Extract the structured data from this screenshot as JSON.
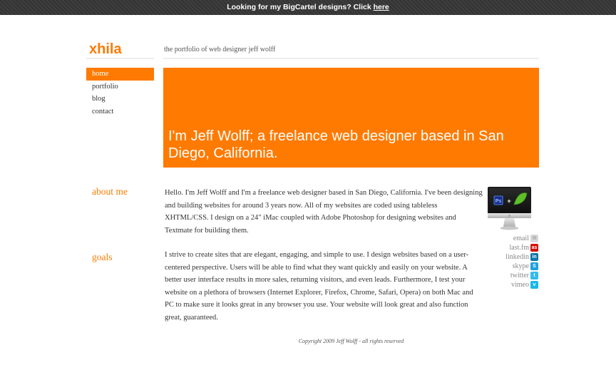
{
  "topbar": {
    "text": "Looking for my BigCartel designs? Click ",
    "link": "here"
  },
  "header": {
    "logo": "xhila",
    "tagline": "the portfolio of web designer jeff wolff"
  },
  "nav": {
    "items": [
      {
        "label": "home"
      },
      {
        "label": "portfolio"
      },
      {
        "label": "blog"
      },
      {
        "label": "contact"
      }
    ]
  },
  "hero": {
    "text": "I'm Jeff Wolff; a freelance web designer based in San Diego, California."
  },
  "about": {
    "heading": "about me",
    "text": "Hello. I'm Jeff Wolff and I'm a freelance web designer based in San Diego, California. I've been designing and building websites for around 3 years now. All of my websites are coded using tableless XHTML/CSS. I design on a 24\" iMac coupled with Adobe Photoshop for designing websites and Textmate for building them."
  },
  "goals": {
    "heading": "goals",
    "text": "I strive to create sites that are elegant, engaging, and simple to use. I design websites based on a user-centered perspective. Users will be able to find what they want quickly and easily on your website. A better user interface results in more sales, returning visitors, and even leads. Furthermore, I test your website on a plethora of browsers (Internet Explorer, Firefox, Chrome, Safari, Opera) on both Mac and PC to make sure it looks great in any browser you use. Your website will look great and also function great, guaranteed."
  },
  "social": [
    {
      "label": "email",
      "icon": "email-icon",
      "color": "#d8d8d8",
      "glyph": "✉"
    },
    {
      "label": "last.fm",
      "icon": "lastfm-icon",
      "color": "#d51007",
      "glyph": "as"
    },
    {
      "label": "linkedin",
      "icon": "linkedin-icon",
      "color": "#0e76a8",
      "glyph": "in"
    },
    {
      "label": "skype",
      "icon": "skype-icon",
      "color": "#1ea0e0",
      "glyph": "S"
    },
    {
      "label": "twitter",
      "icon": "twitter-icon",
      "color": "#33bbee",
      "glyph": "t"
    },
    {
      "label": "vimeo",
      "icon": "vimeo-icon",
      "color": "#1ab7ea",
      "glyph": "v"
    }
  ],
  "footer": {
    "text": "Copyright 2009 Jeff Wolff - all rights reserved"
  },
  "colors": {
    "accent": "#ff7a00",
    "topbar": "#3a3a3a"
  }
}
